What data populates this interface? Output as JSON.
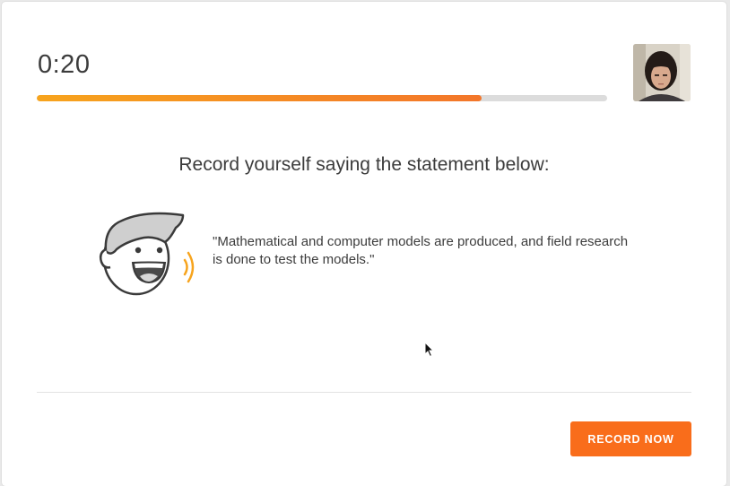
{
  "timer": {
    "value": "0:20"
  },
  "progress": {
    "fraction": 0.78
  },
  "prompt": {
    "text": "Record yourself saying the statement below:"
  },
  "statement": {
    "text": "\"Mathematical and computer models are produced, and field research is done to test the models.\""
  },
  "actions": {
    "record_label": "RECORD NOW"
  },
  "colors": {
    "accent": "#f96d1b",
    "progress_start": "#f7a41d",
    "progress_end": "#f3762a",
    "track": "#dcdcdc",
    "text": "#3c3c3c"
  },
  "icons": {
    "speaker": "speaking-face-icon",
    "webcam": "webcam-preview",
    "cursor": "mouse-cursor-icon"
  }
}
